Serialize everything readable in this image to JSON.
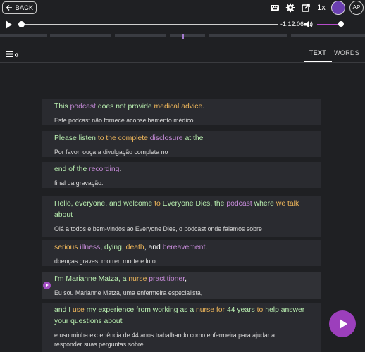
{
  "header": {
    "back_label": "BACK",
    "speed": "1x",
    "ap_label": "AP",
    "icons": [
      "keyboard-icon",
      "gear-icon",
      "share-icon"
    ]
  },
  "player": {
    "time_remaining": "-1:12:06",
    "progress": 0.01,
    "volume": 0.9
  },
  "tabs": {
    "text_label": "TEXT",
    "words_label": "WORDS",
    "active": "TEXT"
  },
  "colors": {
    "green": "#b9efb0",
    "purple": "#c58ad8",
    "orange": "#eeb65a",
    "accent": "#9c3fbc"
  },
  "lines": [
    {
      "en": [
        {
          "t": "This ",
          "c": "green"
        },
        {
          "t": "podcast ",
          "c": "purple"
        },
        {
          "t": "does not provide ",
          "c": "green"
        },
        {
          "t": "medical advice",
          "c": "orange"
        },
        {
          "t": ".",
          "c": "white"
        }
      ],
      "pt": "Este podcast não fornece aconselhamento médico."
    },
    {
      "en": [
        {
          "t": "Please listen ",
          "c": "green"
        },
        {
          "t": "to the ",
          "c": "orange"
        },
        {
          "t": "complete ",
          "c": "orange"
        },
        {
          "t": "disclosure ",
          "c": "purple"
        },
        {
          "t": "at the",
          "c": "green"
        }
      ],
      "pt": "Por favor, ouça a divulgação completa no"
    },
    {
      "en": [
        {
          "t": "end of the ",
          "c": "green"
        },
        {
          "t": "recording",
          "c": "purple"
        },
        {
          "t": ".",
          "c": "white"
        }
      ],
      "pt": "final da gravação."
    },
    {
      "en": [
        {
          "t": "Hello, everyone, and welcome ",
          "c": "green"
        },
        {
          "t": "to ",
          "c": "orange"
        },
        {
          "t": "Everyone Dies, the ",
          "c": "green"
        },
        {
          "t": "podcast ",
          "c": "purple"
        },
        {
          "t": "where ",
          "c": "green"
        },
        {
          "t": "we talk ",
          "c": "orange"
        },
        {
          "t": "about",
          "c": "green"
        }
      ],
      "pt": "Olá a todos e bem-vindos ao Everyone Dies, o podcast onde falamos sobre"
    },
    {
      "en": [
        {
          "t": "serious ",
          "c": "orange"
        },
        {
          "t": "illness",
          "c": "purple"
        },
        {
          "t": ", ",
          "c": "white"
        },
        {
          "t": "dying",
          "c": "green"
        },
        {
          "t": ", ",
          "c": "white"
        },
        {
          "t": "death",
          "c": "orange"
        },
        {
          "t": ", and ",
          "c": "white"
        },
        {
          "t": "bereavement",
          "c": "purple"
        },
        {
          "t": ".",
          "c": "white"
        }
      ],
      "pt": "doenças graves, morrer, morte e luto."
    },
    {
      "en": [
        {
          "t": "I'm ",
          "c": "green"
        },
        {
          "t": "Marianne Matza, a ",
          "c": "green"
        },
        {
          "t": "nurse ",
          "c": "orange"
        },
        {
          "t": "practitioner",
          "c": "purple"
        },
        {
          "t": ",",
          "c": "white"
        }
      ],
      "pt": "Eu sou Marianne Matza, uma enfermeira especialista,"
    },
    {
      "en": [
        {
          "t": "and I ",
          "c": "green"
        },
        {
          "t": "use ",
          "c": "orange"
        },
        {
          "t": "my experience from working as a ",
          "c": "green"
        },
        {
          "t": "nurse for ",
          "c": "orange"
        },
        {
          "t": "44 years ",
          "c": "green"
        },
        {
          "t": "to ",
          "c": "orange"
        },
        {
          "t": "help answer ",
          "c": "green"
        },
        {
          "t": "your questions about",
          "c": "green"
        }
      ],
      "pt": "e uso minha experiência de 44 anos trabalhando como enfermeira para ajudar a responder suas perguntas sobre"
    }
  ]
}
